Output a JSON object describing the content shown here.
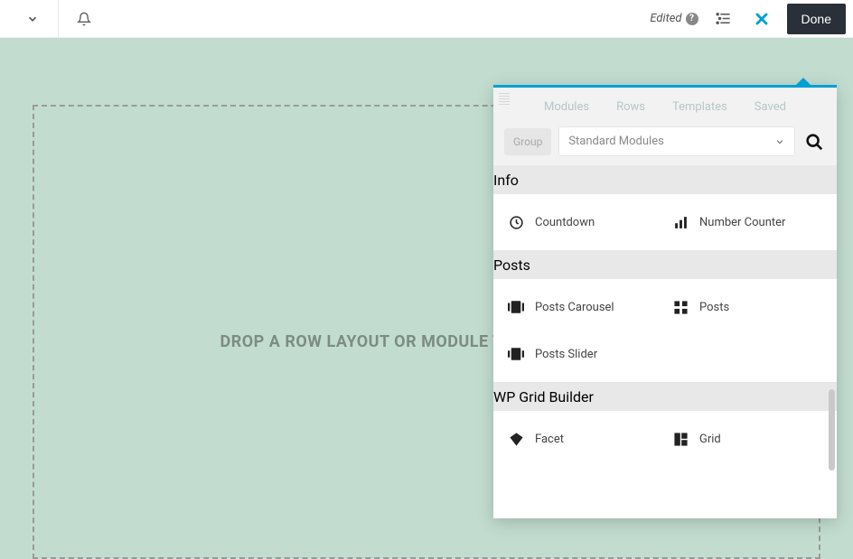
{
  "topbar": {
    "edited_label": "Edited",
    "done_label": "Done"
  },
  "canvas": {
    "dropzone_text": "DROP A ROW LAYOUT OR MODULE TO GET STARTED!"
  },
  "panel": {
    "tabs": {
      "modules": "Modules",
      "rows": "Rows",
      "templates": "Templates",
      "saved": "Saved"
    },
    "filter": {
      "group_label": "Group",
      "select_label": "Standard Modules"
    },
    "sections": [
      {
        "title": "Info",
        "items": [
          {
            "icon": "clock-icon",
            "label": "Countdown"
          },
          {
            "icon": "bars-icon",
            "label": "Number Counter"
          }
        ]
      },
      {
        "title": "Posts",
        "items": [
          {
            "icon": "carousel-icon",
            "label": "Posts Carousel"
          },
          {
            "icon": "grid-icon",
            "label": "Posts"
          },
          {
            "icon": "slider-icon",
            "label": "Posts Slider"
          }
        ]
      },
      {
        "title": "WP Grid Builder",
        "items": [
          {
            "icon": "diamond-icon",
            "label": "Facet"
          },
          {
            "icon": "layout-icon",
            "label": "Grid"
          }
        ]
      }
    ]
  }
}
